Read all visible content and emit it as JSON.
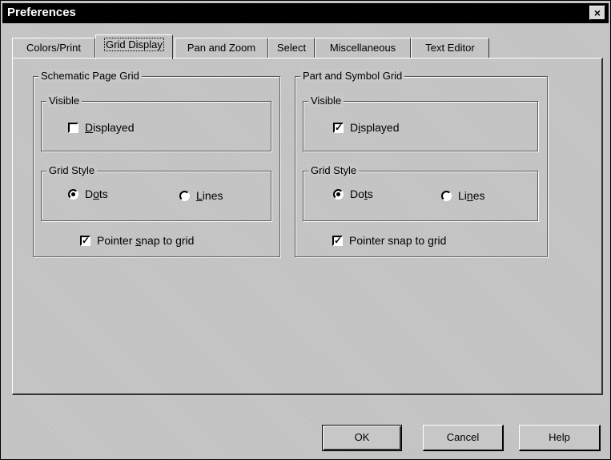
{
  "window": {
    "title": "Preferences",
    "close_label": "×"
  },
  "tabs": [
    {
      "label": "Colors/Print",
      "active": false
    },
    {
      "label": "Grid Display",
      "active": true
    },
    {
      "label": "Pan and Zoom",
      "active": false
    },
    {
      "label": "Select",
      "active": false
    },
    {
      "label": "Miscellaneous",
      "active": false
    },
    {
      "label": "Text Editor",
      "active": false
    }
  ],
  "schematic": {
    "group_label": "Schematic Page Grid",
    "visible": {
      "label": "Visible",
      "displayed_label_pre": "",
      "displayed_label_u": "D",
      "displayed_label_post": "isplayed",
      "displayed_checked": false
    },
    "style": {
      "label": "Grid Style",
      "dots_pre": "D",
      "dots_u": "o",
      "dots_post": "ts",
      "lines_pre": "",
      "lines_u": "L",
      "lines_post": "ines",
      "selected": "Dots"
    },
    "snap": {
      "pre": "Pointer ",
      "u": "s",
      "post": "nap to grid",
      "checked": true
    }
  },
  "part": {
    "group_label": "Part and Symbol Grid",
    "visible": {
      "label": "Visible",
      "displayed_label_pre": "D",
      "displayed_label_u": "i",
      "displayed_label_post": "splayed",
      "displayed_checked": true
    },
    "style": {
      "label": "Grid Style",
      "dots_pre": "Do",
      "dots_u": "t",
      "dots_post": "s",
      "lines_pre": "Li",
      "lines_u": "n",
      "lines_post": "es",
      "selected": "Dots"
    },
    "snap": {
      "pre": "Pointer snap to ",
      "u": "g",
      "post": "rid",
      "checked": true
    }
  },
  "buttons": {
    "ok": "OK",
    "cancel": "Cancel",
    "help": "Help"
  },
  "icons": {
    "check": "check-mark",
    "close": "close-icon"
  }
}
